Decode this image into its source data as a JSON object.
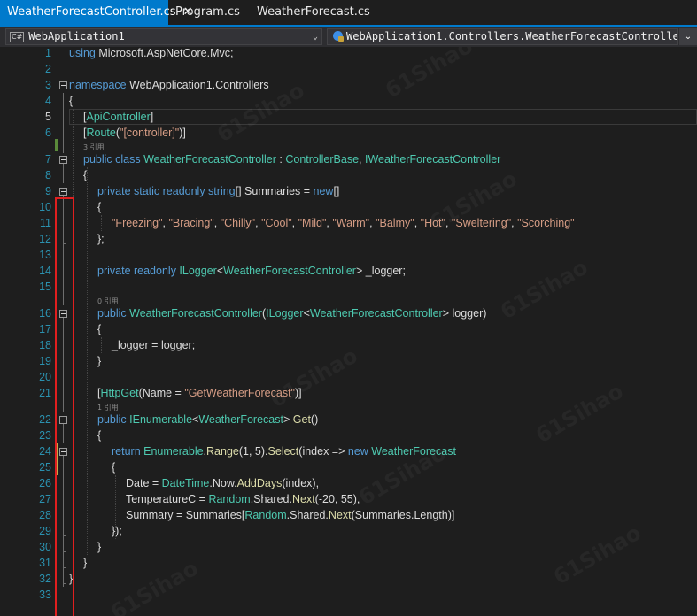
{
  "tabs": [
    {
      "label": "WeatherForecastController.cs",
      "active": true,
      "close": "✕"
    },
    {
      "label": "Program.cs",
      "active": false
    },
    {
      "label": "WeatherForecast.cs",
      "active": false
    }
  ],
  "nav": {
    "lang_badge": "C#",
    "project": "WebApplication1",
    "scope": "WebApplication1.Controllers.WeatherForecastController",
    "chevron": "⌄"
  },
  "lines": [
    {
      "n": "1",
      "tokens": [
        [
          "kw",
          "using"
        ],
        [
          "id",
          " Microsoft.AspNetCore.Mvc;"
        ]
      ]
    },
    {
      "n": "2",
      "tokens": []
    },
    {
      "n": "3",
      "tokens": [
        [
          "kw",
          "namespace"
        ],
        [
          "id",
          " WebApplication1.Controllers"
        ]
      ]
    },
    {
      "n": "4",
      "tokens": [
        [
          "id",
          "{"
        ]
      ]
    },
    {
      "n": "5",
      "tokens": [
        [
          "id",
          "["
        ],
        [
          "ty",
          "ApiController"
        ],
        [
          "id",
          "]"
        ]
      ]
    },
    {
      "n": "6",
      "tokens": [
        [
          "id",
          "["
        ],
        [
          "ty",
          "Route"
        ],
        [
          "id",
          "("
        ],
        [
          "st",
          "\"[controller]\""
        ],
        [
          "id",
          ")]"
        ]
      ]
    },
    {
      "n": "7",
      "tokens": [
        [
          "kw",
          "public class "
        ],
        [
          "ty",
          "WeatherForecastController"
        ],
        [
          "id",
          " : "
        ],
        [
          "ty",
          "ControllerBase"
        ],
        [
          "id",
          ", "
        ],
        [
          "ty",
          "IWeatherForecastController"
        ]
      ]
    },
    {
      "n": "8",
      "tokens": [
        [
          "id",
          "{"
        ]
      ]
    },
    {
      "n": "9",
      "tokens": [
        [
          "kw",
          "private static readonly string"
        ],
        [
          "id",
          "[] Summaries = "
        ],
        [
          "kw",
          "new"
        ],
        [
          "id",
          "[]"
        ]
      ]
    },
    {
      "n": "10",
      "tokens": [
        [
          "id",
          "{"
        ]
      ]
    },
    {
      "n": "11",
      "tokens": [
        [
          "st",
          "\"Freezing\""
        ],
        [
          "id",
          ", "
        ],
        [
          "st",
          "\"Bracing\""
        ],
        [
          "id",
          ", "
        ],
        [
          "st",
          "\"Chilly\""
        ],
        [
          "id",
          ", "
        ],
        [
          "st",
          "\"Cool\""
        ],
        [
          "id",
          ", "
        ],
        [
          "st",
          "\"Mild\""
        ],
        [
          "id",
          ", "
        ],
        [
          "st",
          "\"Warm\""
        ],
        [
          "id",
          ", "
        ],
        [
          "st",
          "\"Balmy\""
        ],
        [
          "id",
          ", "
        ],
        [
          "st",
          "\"Hot\""
        ],
        [
          "id",
          ", "
        ],
        [
          "st",
          "\"Sweltering\""
        ],
        [
          "id",
          ", "
        ],
        [
          "st",
          "\"Scorching\""
        ]
      ]
    },
    {
      "n": "12",
      "tokens": [
        [
          "id",
          "};"
        ]
      ]
    },
    {
      "n": "13",
      "tokens": []
    },
    {
      "n": "14",
      "tokens": [
        [
          "kw",
          "private readonly "
        ],
        [
          "ty",
          "ILogger"
        ],
        [
          "id",
          "<"
        ],
        [
          "ty",
          "WeatherForecastController"
        ],
        [
          "id",
          "> _logger;"
        ]
      ]
    },
    {
      "n": "15",
      "tokens": []
    },
    {
      "n": "16",
      "tokens": [
        [
          "kw",
          "public "
        ],
        [
          "ty",
          "WeatherForecastController"
        ],
        [
          "id",
          "("
        ],
        [
          "ty",
          "ILogger"
        ],
        [
          "id",
          "<"
        ],
        [
          "ty",
          "WeatherForecastController"
        ],
        [
          "id",
          "> logger)"
        ]
      ]
    },
    {
      "n": "17",
      "tokens": [
        [
          "id",
          "{"
        ]
      ]
    },
    {
      "n": "18",
      "tokens": [
        [
          "id",
          "_logger = logger;"
        ]
      ]
    },
    {
      "n": "19",
      "tokens": [
        [
          "id",
          "}"
        ]
      ]
    },
    {
      "n": "20",
      "tokens": []
    },
    {
      "n": "21",
      "tokens": [
        [
          "id",
          "["
        ],
        [
          "ty",
          "HttpGet"
        ],
        [
          "id",
          "(Name = "
        ],
        [
          "st",
          "\"GetWeatherForecast\""
        ],
        [
          "id",
          ")]"
        ]
      ]
    },
    {
      "n": "22",
      "tokens": [
        [
          "kw",
          "public "
        ],
        [
          "ty",
          "IEnumerable"
        ],
        [
          "id",
          "<"
        ],
        [
          "ty",
          "WeatherForecast"
        ],
        [
          "id",
          "> "
        ],
        [
          "mt",
          "Get"
        ],
        [
          "id",
          "()"
        ]
      ]
    },
    {
      "n": "23",
      "tokens": [
        [
          "id",
          "{"
        ]
      ]
    },
    {
      "n": "24",
      "tokens": [
        [
          "kw",
          "return "
        ],
        [
          "ty",
          "Enumerable"
        ],
        [
          "id",
          "."
        ],
        [
          "mt",
          "Range"
        ],
        [
          "id",
          "(1, 5)."
        ],
        [
          "mt",
          "Select"
        ],
        [
          "id",
          "(index => "
        ],
        [
          "kw",
          "new "
        ],
        [
          "ty",
          "WeatherForecast"
        ]
      ]
    },
    {
      "n": "25",
      "tokens": [
        [
          "id",
          "{"
        ]
      ]
    },
    {
      "n": "26",
      "tokens": [
        [
          "id",
          "Date = "
        ],
        [
          "ty",
          "DateTime"
        ],
        [
          "id",
          ".Now."
        ],
        [
          "mt",
          "AddDays"
        ],
        [
          "id",
          "(index),"
        ]
      ]
    },
    {
      "n": "27",
      "tokens": [
        [
          "id",
          "TemperatureC = "
        ],
        [
          "ty",
          "Random"
        ],
        [
          "id",
          ".Shared."
        ],
        [
          "mt",
          "Next"
        ],
        [
          "id",
          "(-20, 55),"
        ]
      ]
    },
    {
      "n": "28",
      "tokens": [
        [
          "id",
          "Summary = Summaries["
        ],
        [
          "ty",
          "Random"
        ],
        [
          "id",
          ".Shared."
        ],
        [
          "mt",
          "Next"
        ],
        [
          "id",
          "(Summaries.Length)]"
        ]
      ]
    },
    {
      "n": "29",
      "tokens": [
        [
          "id",
          "});"
        ]
      ]
    },
    {
      "n": "30",
      "tokens": [
        [
          "id",
          "}"
        ]
      ]
    },
    {
      "n": "31",
      "tokens": [
        [
          "id",
          "}"
        ]
      ]
    },
    {
      "n": "32",
      "tokens": [
        [
          "id",
          "}"
        ]
      ]
    },
    {
      "n": "33",
      "tokens": []
    }
  ],
  "codelens": [
    {
      "after_line": "6",
      "text": "3 引用"
    },
    {
      "after_line": "15",
      "text": "0 引用"
    },
    {
      "after_line": "21",
      "text": "1 引用"
    }
  ],
  "watermark": "61Sihao",
  "colors": {
    "keyword": "#569cd6",
    "type": "#4ec9b0",
    "string": "#d69d85",
    "method": "#dcdcaa",
    "text": "#dcdcdc",
    "linenum": "#2b91af",
    "highlight": "#e01f1f",
    "tab_active": "#007acc"
  }
}
